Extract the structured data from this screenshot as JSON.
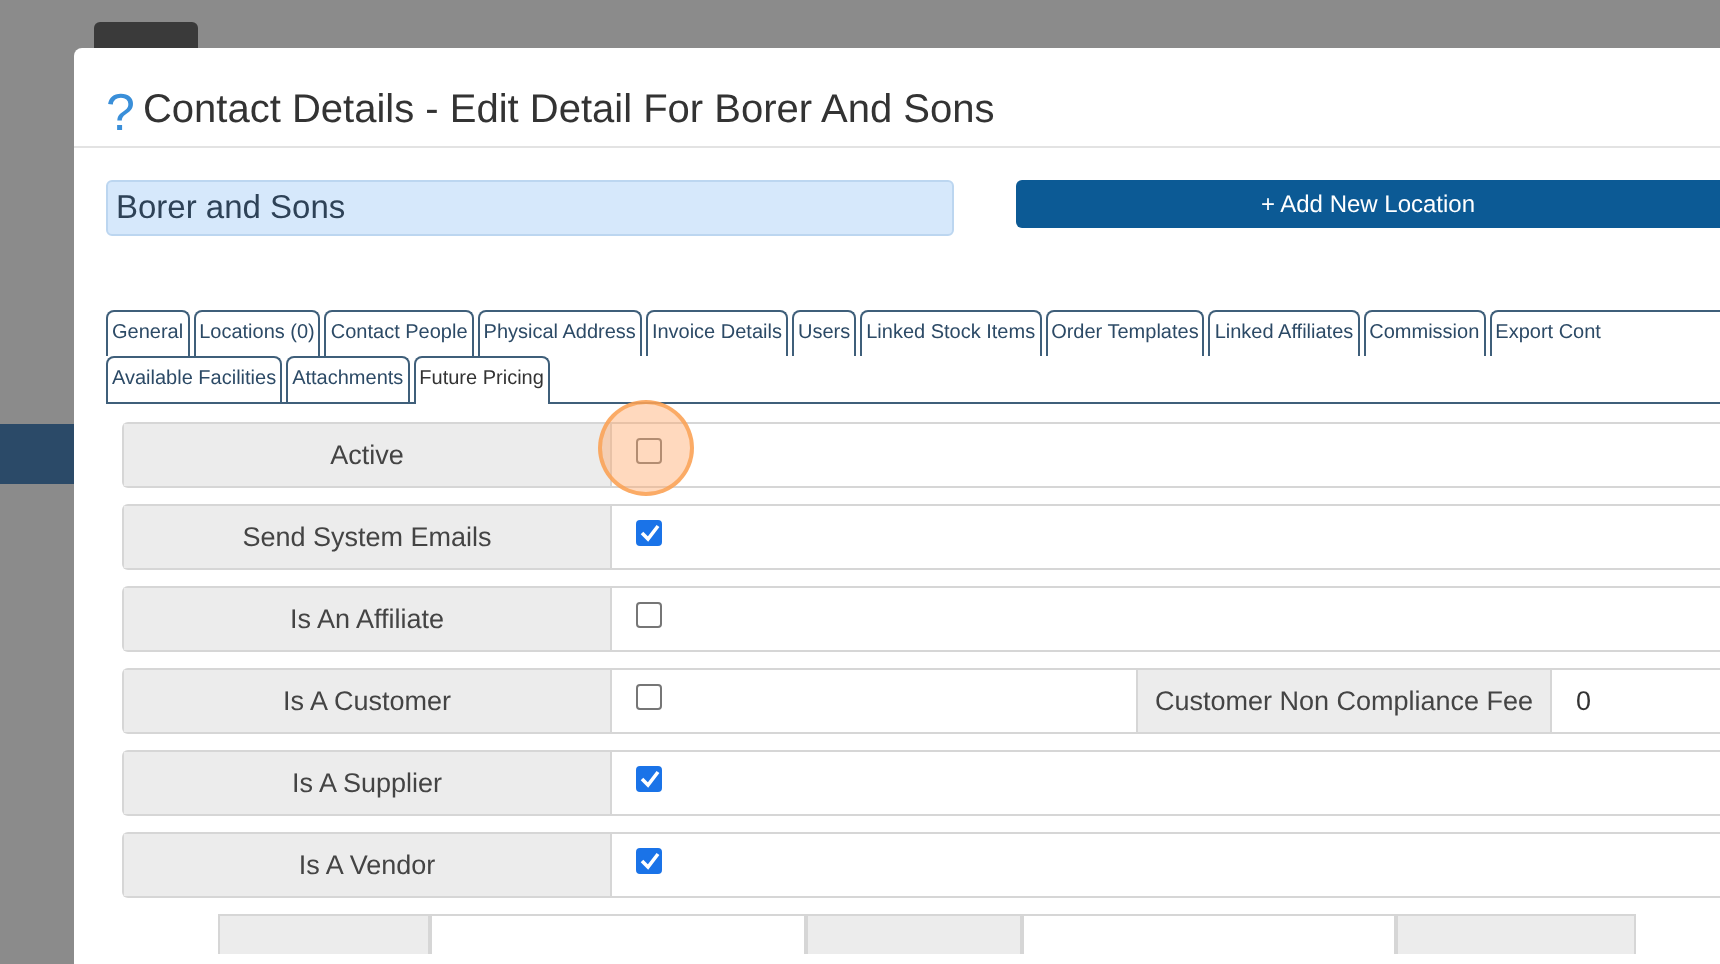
{
  "dialog": {
    "help_icon": "?",
    "title": "Contact Details - Edit Detail For Borer And Sons"
  },
  "name_field": {
    "value": "Borer and Sons"
  },
  "add_location_button": {
    "label": "+ Add New Location"
  },
  "tabs": [
    {
      "label": "General",
      "selected": false
    },
    {
      "label": "Locations (0)",
      "selected": false
    },
    {
      "label": "Contact People",
      "selected": false
    },
    {
      "label": "Physical Address",
      "selected": false
    },
    {
      "label": "Invoice Details",
      "selected": false
    },
    {
      "label": "Users",
      "selected": false
    },
    {
      "label": "Linked Stock Items",
      "selected": false
    },
    {
      "label": "Order Templates",
      "selected": false
    },
    {
      "label": "Linked Affiliates",
      "selected": false
    },
    {
      "label": "Commission",
      "selected": false
    },
    {
      "label": "Export Cont",
      "selected": false
    },
    {
      "label": "Available Facilities",
      "selected": false
    },
    {
      "label": "Attachments",
      "selected": false
    },
    {
      "label": "Future Pricing",
      "selected": true
    }
  ],
  "rows": [
    {
      "label": "Active",
      "checked": false,
      "highlighted": true
    },
    {
      "label": "Send System Emails",
      "checked": true,
      "highlighted": false
    },
    {
      "label": "Is An Affiliate",
      "checked": false,
      "highlighted": false
    },
    {
      "label": "Is A Customer",
      "checked": false,
      "highlighted": false,
      "extra_label": "Customer Non Compliance Fee",
      "extra_value": "0"
    },
    {
      "label": "Is A Supplier",
      "checked": true,
      "highlighted": false
    },
    {
      "label": "Is A Vendor",
      "checked": true,
      "highlighted": false
    }
  ]
}
